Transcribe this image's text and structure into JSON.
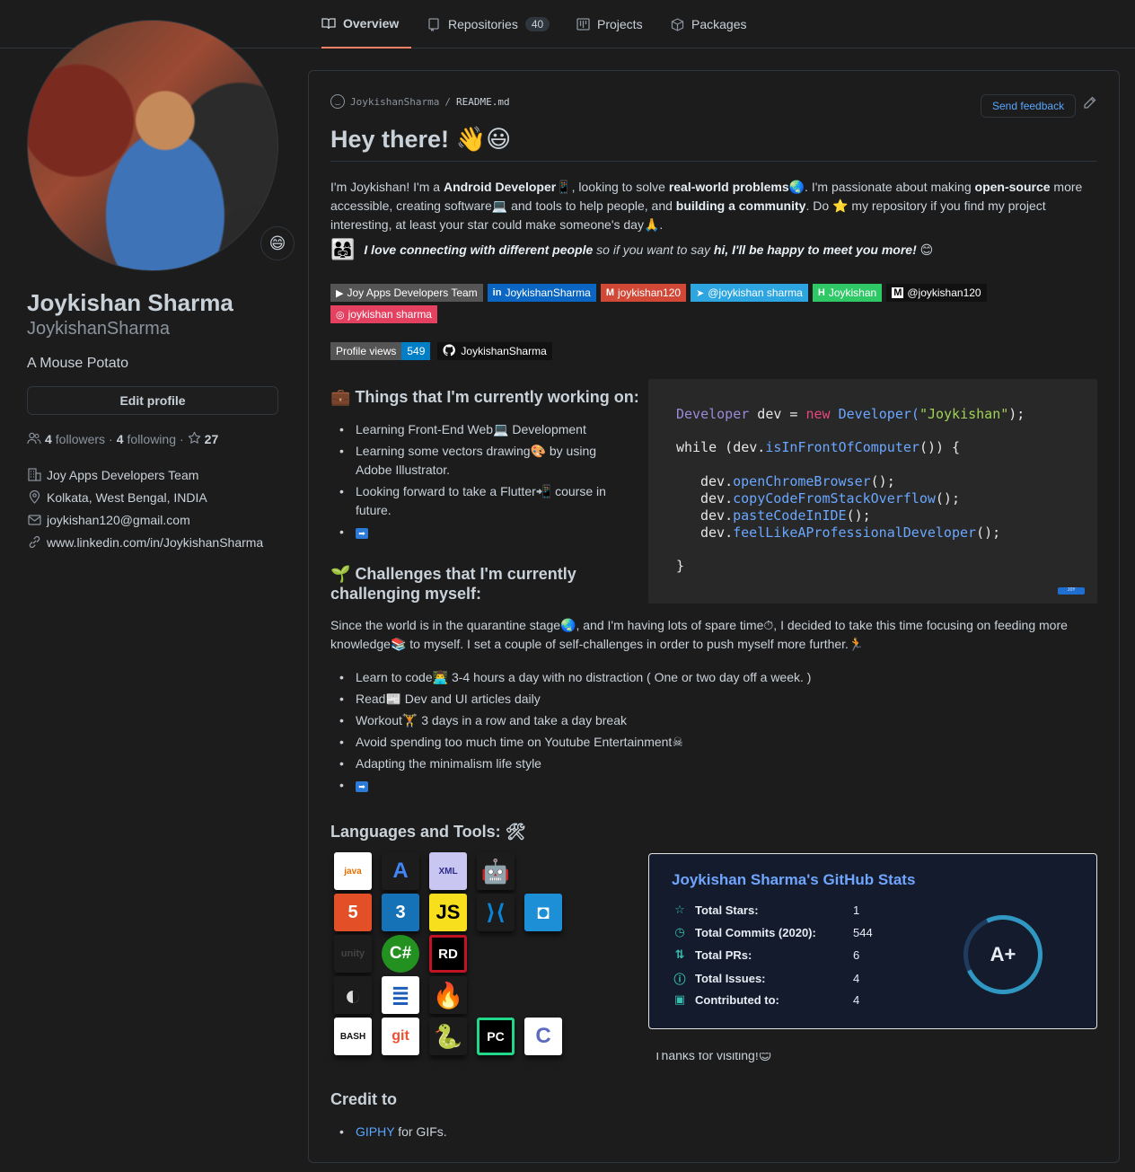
{
  "tabs": {
    "overview": "Overview",
    "repositories": "Repositories",
    "repositories_count": "40",
    "projects": "Projects",
    "packages": "Packages"
  },
  "profile": {
    "status_emoji": "😄",
    "name": "Joykishan Sharma",
    "login": "JoykishanSharma",
    "bio": "A Mouse Potato",
    "edit_label": "Edit profile",
    "followers_count": "4",
    "followers_label": "followers",
    "following_count": "4",
    "following_label": "following",
    "stars_count": "27",
    "company": "Joy Apps Developers Team",
    "location": "Kolkata, West Bengal, INDIA",
    "email": "joykishan120@gmail.com",
    "website": "www.linkedin.com/in/JoykishanSharma"
  },
  "readme": {
    "owner": "JoykishanSharma",
    "file": "README.md",
    "feedback_label": "Send feedback",
    "heading": "Hey there!",
    "heading_emoji": "👋😃",
    "intro": {
      "t1": "I'm Joykishan! I'm a ",
      "b1": "Android Developer",
      "t2": "📱, looking to solve ",
      "b2": "real-world problems",
      "t3": "🌏. I'm passionate about making ",
      "b3": "open-source",
      "t4": " more accessible, creating software💻 and tools to help people, and ",
      "b4": "building a community",
      "t5": ". Do ⭐ my repository if you find my project interesting, at least your star could make someone's day🙏."
    },
    "connect": {
      "emoji": "👨‍👩‍👧",
      "b1": "I love connecting with different people",
      "t1": " so if you want to say ",
      "b2": "hi, I'll be happy to meet you more!",
      "t2": " 😊"
    },
    "badges": [
      {
        "label": "Joy Apps Developers Team",
        "mark": "▶"
      },
      {
        "label": "JoykishanSharma",
        "mark": "in"
      },
      {
        "label": "joykishan120",
        "mark": "M"
      },
      {
        "label": "@joykishan sharma",
        "mark": "➤"
      },
      {
        "label": "Joykishan",
        "mark": "H"
      },
      {
        "label": "@joykishan120",
        "mark": "M"
      },
      {
        "label": "joykishan sharma",
        "mark": "◎"
      }
    ],
    "views": {
      "label": "Profile views",
      "count": "549",
      "gh_label": "JoykishanSharma"
    },
    "working": {
      "icon": "💼",
      "title": "Things that I'm currently working on:",
      "items": [
        "Learning Front-End Web💻 Development",
        "Learning some vectors drawing🎨 by using Adobe Illustrator.",
        "Looking forward to take a Flutter📲 course in future."
      ]
    },
    "code": {
      "l1a": "Developer",
      "l1b": " dev = ",
      "l1c": "new",
      "l1d": " Developer(",
      "l1e": "\"Joykishan\"",
      "l1f": ");",
      "l2a": "while",
      "l2b": " (dev.",
      "l2c": "isInFrontOfComputer",
      "l2d": "()) {",
      "l3": "openChromeBrowser",
      "l4": "copyCodeFromStackOverflow",
      "l5": "pasteCodeInIDE",
      "l6": "feelLikeAProfessionalDeveloper",
      "prefix": "dev.",
      "suffix": "();",
      "close": "}",
      "tag": "JOY"
    },
    "challenges": {
      "icon": "🌱",
      "title": "Challenges that I'm currently challenging myself:",
      "intro": "Since the world is in the quarantine stage🌏, and I'm having lots of spare time⏱, I decided to take this time focusing on feeding more knowledge📚 to myself. I set a couple of self-challenges in order to push myself more further.🏃",
      "items": [
        "Learn to code👨‍💻 3-4 hours a day with no distraction ( One or two day off a week. )",
        "Read📰 Dev and UI articles daily",
        "Workout🏋 3 days in a row and take a day break",
        "Avoid spending too much time on Youtube Entertainment☠",
        "Adapting the minimalism life style"
      ]
    },
    "tools": {
      "title": "Languages and Tools:",
      "title_icon": "🛠",
      "items": [
        "java",
        "A",
        "XML",
        "🤖",
        "5",
        "3",
        "JS",
        "⟩⟨",
        "◘",
        "unity",
        "C#",
        "RD",
        "◐",
        "≣",
        "🔥",
        "BASH",
        "git",
        "🐍",
        "PC",
        "C"
      ]
    },
    "stats": {
      "title": "Joykishan Sharma's GitHub Stats",
      "rows": [
        {
          "icon": "☆",
          "label": "Total Stars:",
          "value": "1"
        },
        {
          "icon": "◷",
          "label": "Total Commits (2020):",
          "value": "544"
        },
        {
          "icon": "⇅",
          "label": "Total PRs:",
          "value": "6"
        },
        {
          "icon": "ⓘ",
          "label": "Total Issues:",
          "value": "4"
        },
        {
          "icon": "▣",
          "label": "Contributed to:",
          "value": "4"
        }
      ],
      "grade": "A+"
    },
    "thanks": "Thanks for visiting!😊",
    "credit": {
      "title": "Credit to",
      "link": "GIPHY",
      "rest": " for GIFs."
    }
  }
}
